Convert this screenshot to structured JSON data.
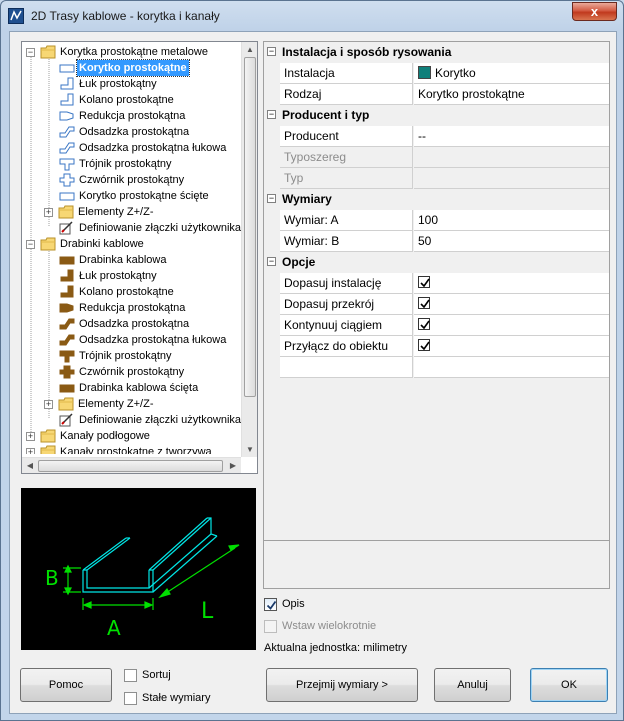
{
  "window": {
    "title": "2D Trasy kablowe - korytka i kanały",
    "close_label": "x"
  },
  "tree": {
    "items": [
      {
        "label": "Korytka prostokątne metalowe",
        "level": 0,
        "expander": "−",
        "icon": "folder-icon"
      },
      {
        "label": "Korytko prostokątne",
        "level": 1,
        "icon": "tray-icon",
        "selected": true
      },
      {
        "label": "Łuk prostokątny",
        "level": 1,
        "icon": "elbow-icon"
      },
      {
        "label": "Kolano prostokątne",
        "level": 1,
        "icon": "knee-icon"
      },
      {
        "label": "Redukcja prostokątna",
        "level": 1,
        "icon": "reducer-icon"
      },
      {
        "label": "Odsadzka prostokątna",
        "level": 1,
        "icon": "offset-icon"
      },
      {
        "label": "Odsadzka prostokątna łukowa",
        "level": 1,
        "icon": "offset-arc-icon"
      },
      {
        "label": "Trójnik prostokątny",
        "level": 1,
        "icon": "tee-icon"
      },
      {
        "label": "Czwórnik prostokątny",
        "level": 1,
        "icon": "cross-icon"
      },
      {
        "label": "Korytko prostokątne ścięte",
        "level": 1,
        "icon": "tray-cut-icon"
      },
      {
        "label": "Elementy Z+/Z-",
        "level": 1,
        "expander": "+",
        "icon": "folder-icon"
      },
      {
        "label": "Definiowanie złączki użytkownika",
        "level": 1,
        "icon": "user-fitting-icon"
      },
      {
        "label": "Drabinki kablowe",
        "level": 0,
        "expander": "−",
        "icon": "folder-icon"
      },
      {
        "label": "Drabinka kablowa",
        "level": 1,
        "icon": "ladder-icon"
      },
      {
        "label": "Łuk prostokątny",
        "level": 1,
        "icon": "ladder-elbow-icon"
      },
      {
        "label": "Kolano prostokątne",
        "level": 1,
        "icon": "ladder-knee-icon"
      },
      {
        "label": "Redukcja prostokątna",
        "level": 1,
        "icon": "ladder-reducer-icon"
      },
      {
        "label": "Odsadzka prostokątna",
        "level": 1,
        "icon": "ladder-offset-icon"
      },
      {
        "label": "Odsadzka prostokątna łukowa",
        "level": 1,
        "icon": "ladder-offset-arc-icon"
      },
      {
        "label": "Trójnik prostokątny",
        "level": 1,
        "icon": "ladder-tee-icon"
      },
      {
        "label": "Czwórnik prostokątny",
        "level": 1,
        "icon": "ladder-cross-icon"
      },
      {
        "label": "Drabinka kablowa ścięta",
        "level": 1,
        "icon": "ladder-cut-icon"
      },
      {
        "label": "Elementy Z+/Z-",
        "level": 1,
        "expander": "+",
        "icon": "folder-icon"
      },
      {
        "label": "Definiowanie złączki użytkownika",
        "level": 1,
        "icon": "user-fitting-icon"
      },
      {
        "label": "Kanały podłogowe",
        "level": 0,
        "expander": "+",
        "icon": "folder-icon"
      },
      {
        "label": "Kanały prostokątne z tworzywa",
        "level": 0,
        "expander": "+",
        "icon": "folder-icon"
      }
    ]
  },
  "preview": {
    "label_a": "A",
    "label_b": "B",
    "label_l": "L"
  },
  "properties": {
    "cat_install": "Instalacja i sposób rysowania",
    "install_key": "Instalacja",
    "install_val": "Korytko",
    "install_color": "#0f7f7a",
    "rodzaj_key": "Rodzaj",
    "rodzaj_val": "Korytko prostokątne",
    "cat_producer": "Producent i typ",
    "producent_key": "Producent",
    "producent_val": "--",
    "typoszereg_key": "Typoszereg",
    "typ_key": "Typ",
    "cat_dims": "Wymiary",
    "dim_a_key": "Wymiar: A",
    "dim_a_val": "100",
    "dim_b_key": "Wymiar: B",
    "dim_b_val": "50",
    "cat_options": "Opcje",
    "opt1_key": "Dopasuj instalację",
    "opt2_key": "Dopasuj przekrój",
    "opt3_key": "Kontynuuj ciągiem",
    "opt4_key": "Przyłącz do obiektu"
  },
  "options": {
    "opis": "Opis",
    "wstaw": "Wstaw wielokrotnie",
    "unit": "Aktualna jednostka: milimetry",
    "sortuj": "Sortuj",
    "stale": "Stałe wymiary"
  },
  "buttons": {
    "help": "Pomoc",
    "take_dims": "Przejmij wymiary  >",
    "cancel": "Anuluj",
    "ok": "OK"
  }
}
